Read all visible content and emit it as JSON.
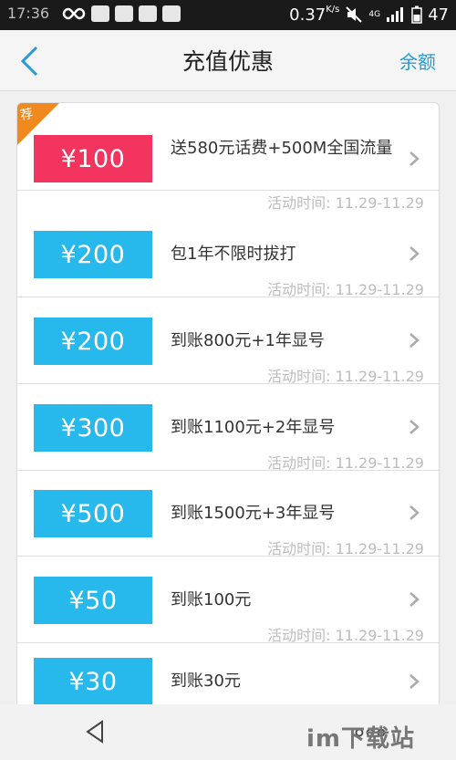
{
  "status_bar": {
    "time": "17:36",
    "speed": "0.37",
    "speed_unit": "K/s",
    "network": "4G",
    "battery": "47"
  },
  "header": {
    "title": "充值优惠",
    "balance_link": "余额"
  },
  "ribbon_label": "荐",
  "offers": [
    {
      "price": "¥100",
      "desc": "送580元话费+500M全国流量",
      "time": "活动时间: 11.29-11.29",
      "highlight": true
    },
    {
      "price": "¥200",
      "desc": "包1年不限时拔打",
      "time": "活动时间: 11.29-11.29",
      "highlight": false
    },
    {
      "price": "¥200",
      "desc": "到账800元+1年显号",
      "time": "活动时间: 11.29-11.29",
      "highlight": false
    },
    {
      "price": "¥300",
      "desc": "到账1100元+2年显号",
      "time": "活动时间: 11.29-11.29",
      "highlight": false
    },
    {
      "price": "¥500",
      "desc": "到账1500元+3年显号",
      "time": "活动时间: 11.29-11.29",
      "highlight": false
    },
    {
      "price": "¥50",
      "desc": "到账100元",
      "time": "活动时间: 11.29-11.29",
      "highlight": false
    },
    {
      "price": "¥30",
      "desc": "到账30元",
      "time": "",
      "highlight": false
    }
  ],
  "watermark": "im下载站",
  "colors": {
    "accent_blue": "#28b9ec",
    "hot_pink": "#f2345f",
    "ribbon_orange": "#f08a1e",
    "link_blue": "#2a9ad6"
  }
}
